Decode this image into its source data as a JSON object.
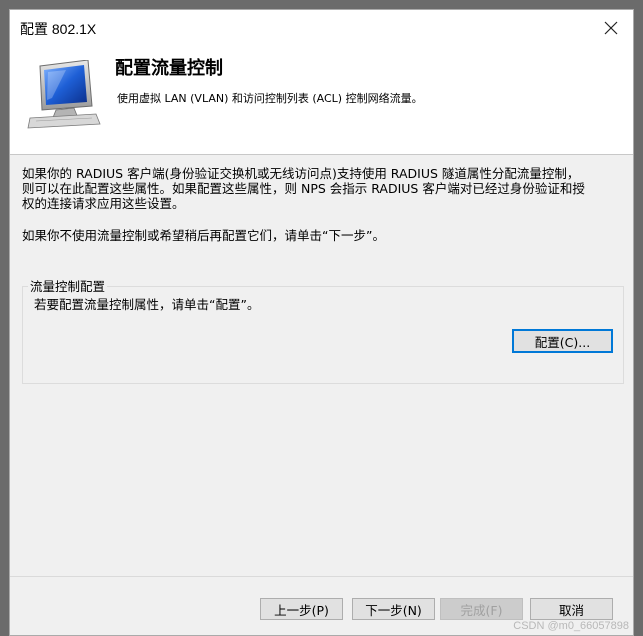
{
  "window": {
    "title": "配置 802.1X",
    "close_icon": "close-icon"
  },
  "header": {
    "title": "配置流量控制",
    "subtitle": "使用虚拟 LAN (VLAN) 和访问控制列表 (ACL) 控制网络流量。",
    "icon": "computer-monitor-icon"
  },
  "content": {
    "paragraph1_line1": "如果你的 RADIUS 客户端(身份验证交换机或无线访问点)支持使用 RADIUS 隧道属性分配流量控制，",
    "paragraph1_line2": "则可以在此配置这些属性。如果配置这些属性，则 NPS 会指示 RADIUS 客户端对已经过身份验证和授",
    "paragraph1_line3": "权的连接请求应用这些设置。",
    "paragraph2": "如果你不使用流量控制或希望稍后再配置它们，请单击“下一步”。"
  },
  "group": {
    "legend": "流量控制配置",
    "description": "若要配置流量控制属性，请单击“配置”。",
    "configure_label": "配置(C)..."
  },
  "footer": {
    "prev_label": "上一步(P)",
    "next_label": "下一步(N)",
    "finish_label": "完成(F)",
    "cancel_label": "取消"
  },
  "watermark": "CSDN @m0_66057898",
  "colors": {
    "focus_border": "#0078d7",
    "window_bg": "#f0f0f0",
    "header_bg": "#ffffff"
  }
}
